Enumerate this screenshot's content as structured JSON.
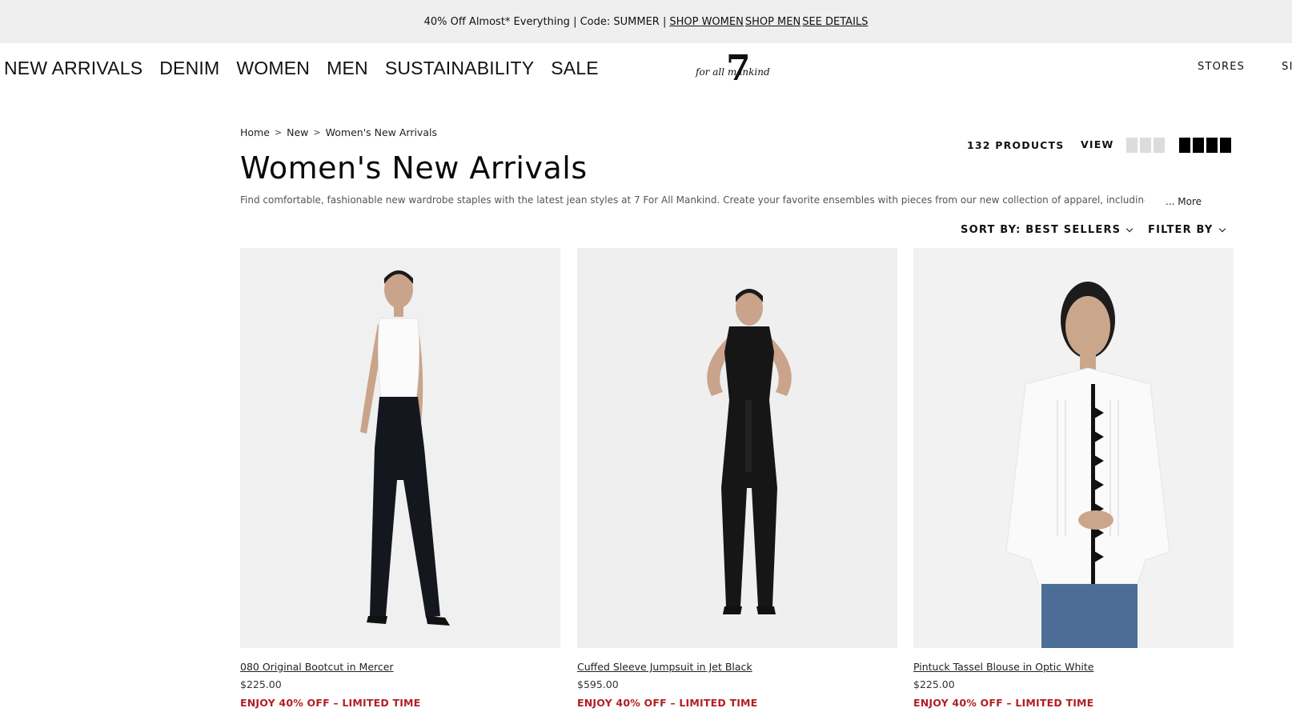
{
  "promo_bar": {
    "text": "40% Off Almost* Everything | Code: SUMMER |",
    "links": [
      "SHOP WOMEN",
      "SHOP MEN",
      "SEE DETAILS"
    ]
  },
  "nav": {
    "items": [
      "NEW ARRIVALS",
      "DENIM",
      "WOMEN",
      "MEN",
      "SUSTAINABILITY",
      "SALE"
    ]
  },
  "logo": {
    "numeral": "7",
    "script_text": "for all mankind"
  },
  "header_links": [
    "STORES",
    "SIGN IN"
  ],
  "breadcrumb": [
    "Home",
    "New",
    "Women's New Arrivals"
  ],
  "breadcrumb_separator": ">",
  "page_title": "Women's New Arrivals",
  "description": "Find comfortable, fashionable new wardrobe staples with the latest jean styles at 7 For All Mankind. Create your favorite ensembles with pieces from our new collection of apparel, including",
  "more_label": "... More",
  "toolbar": {
    "product_count": "132 PRODUCTS",
    "view_label": "VIEW",
    "sort_label": "SORT BY: BEST SELLERS",
    "filter_label": "FILTER BY"
  },
  "products": [
    {
      "name": "080 Original Bootcut in Mercer",
      "price": "$225.00",
      "promo": "ENJOY 40% OFF – LIMITED TIME"
    },
    {
      "name": "Cuffed Sleeve Jumpsuit in Jet Black",
      "price": "$595.00",
      "promo": "ENJOY 40% OFF – LIMITED TIME"
    },
    {
      "name": "Pintuck Tassel Blouse in Optic White",
      "price": "$225.00",
      "promo": "ENJOY 40% OFF – LIMITED TIME"
    }
  ],
  "colors": {
    "promo_bg": "#efefef",
    "promo_red": "#b21f24",
    "view_inactive": "#dcdcdc",
    "view_active": "#000000"
  }
}
